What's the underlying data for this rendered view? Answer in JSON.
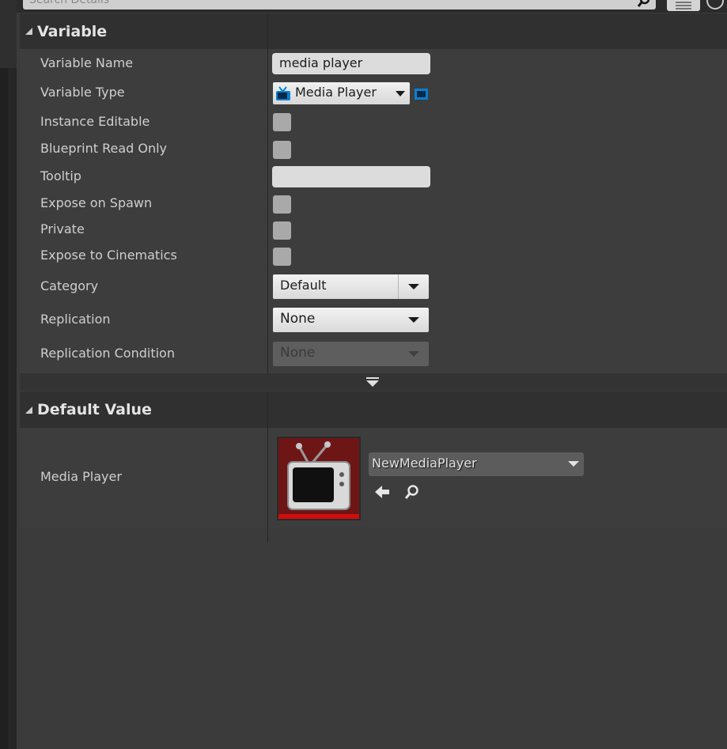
{
  "search": {
    "placeholder": "Search Details"
  },
  "variable_section": {
    "title": "Variable",
    "rows": {
      "variable_name": {
        "label": "Variable Name",
        "value": "media player"
      },
      "variable_type": {
        "label": "Variable Type",
        "value": "Media Player"
      },
      "instance_editable": {
        "label": "Instance Editable",
        "checked": false
      },
      "blueprint_read_only": {
        "label": "Blueprint Read Only",
        "checked": false
      },
      "tooltip": {
        "label": "Tooltip",
        "value": ""
      },
      "expose_on_spawn": {
        "label": "Expose on Spawn",
        "checked": false
      },
      "private": {
        "label": "Private",
        "checked": false
      },
      "expose_to_cinematics": {
        "label": "Expose to Cinematics",
        "checked": false
      },
      "category": {
        "label": "Category",
        "value": "Default"
      },
      "replication": {
        "label": "Replication",
        "value": "None"
      },
      "replication_condition": {
        "label": "Replication Condition",
        "value": "None",
        "enabled": false
      }
    }
  },
  "default_value_section": {
    "title": "Default Value",
    "media_player": {
      "label": "Media Player",
      "asset": "NewMediaPlayer"
    }
  },
  "colors": {
    "panel_bg": "#3d3d3e",
    "header_bg": "#303031",
    "checkbox": "#a9a9a9",
    "thumb_bg": "#6e1616",
    "thumb_accent": "#d10d0d",
    "type_icon": "#0a7fd0"
  },
  "icons": {
    "search": "magnifier-icon",
    "view_options": "list-icon",
    "type": "tv-icon",
    "container_type": "single-variable-icon",
    "advanced": "chevron-down-icon",
    "use_selected": "arrow-left-icon",
    "browse": "magnifier-icon"
  }
}
